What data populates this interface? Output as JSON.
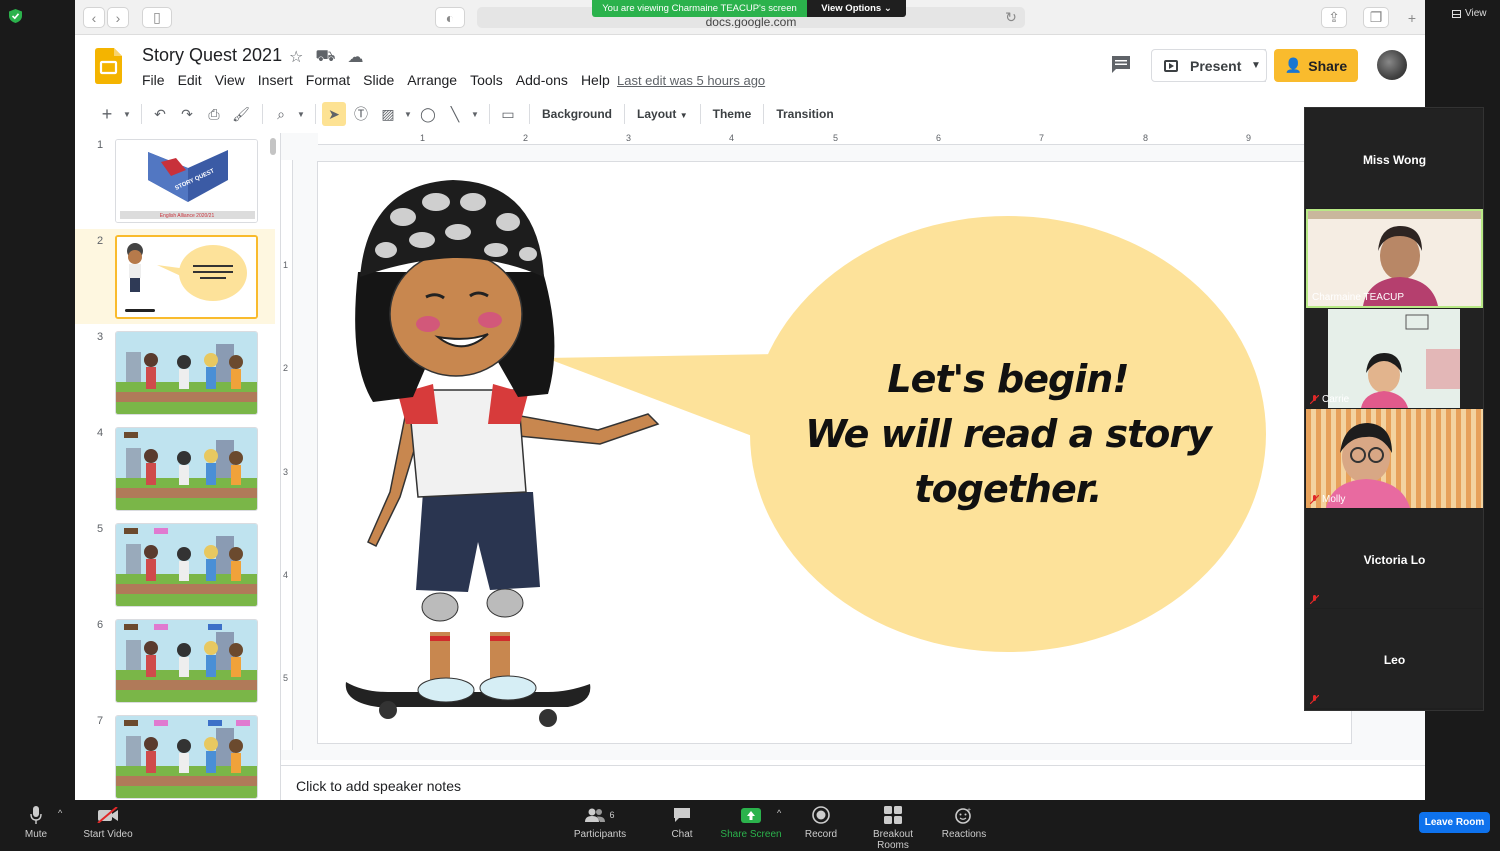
{
  "zoom": {
    "view_label": "View",
    "banner": {
      "viewing_text": "You are viewing Charmaine TEACUP's screen",
      "view_options": "View Options"
    },
    "participants_count": "6",
    "bottom_bar": [
      {
        "label": "Mute",
        "icon": "microphone-icon"
      },
      {
        "label": "Start Video",
        "icon": "video-off-icon"
      },
      {
        "label": "Participants",
        "icon": "participants-icon"
      },
      {
        "label": "Chat",
        "icon": "chat-icon"
      },
      {
        "label": "Share Screen",
        "icon": "share-screen-icon"
      },
      {
        "label": "Record",
        "icon": "record-icon"
      },
      {
        "label": "Breakout Rooms",
        "icon": "breakout-rooms-icon"
      },
      {
        "label": "Reactions",
        "icon": "reactions-icon"
      }
    ],
    "leave_label": "Leave Room",
    "gallery": [
      {
        "name": "Miss Wong",
        "video": false,
        "muted": false
      },
      {
        "name": "Charmaine TEACUP",
        "video": true,
        "muted": false
      },
      {
        "name": "Carrie",
        "video": true,
        "muted": true
      },
      {
        "name": "Molly",
        "video": true,
        "muted": true
      },
      {
        "name": "Victoria Lo",
        "video": false,
        "muted": true
      },
      {
        "name": "Leo",
        "video": false,
        "muted": true
      }
    ]
  },
  "browser": {
    "url": "docs.google.com"
  },
  "slides": {
    "title": "Story Quest 2021",
    "menu": [
      "File",
      "Edit",
      "View",
      "Insert",
      "Format",
      "Slide",
      "Arrange",
      "Tools",
      "Add-ons",
      "Help"
    ],
    "last_edit": "Last edit was 5 hours ago",
    "present_label": "Present",
    "share_label": "Share",
    "toolbar": {
      "background": "Background",
      "layout": "Layout",
      "theme": "Theme",
      "transition": "Transition"
    },
    "ruler_top": [
      "1",
      "2",
      "3",
      "4",
      "5",
      "6",
      "7",
      "8",
      "9"
    ],
    "ruler_left": [
      "1",
      "2",
      "3",
      "4",
      "5"
    ],
    "thumbnails": [
      "1",
      "2",
      "3",
      "4",
      "5",
      "6",
      "7"
    ],
    "selected_slide": 2,
    "thumb1_caption": "English Alliance 2020/21",
    "thumb1_logo_text": "STORY QUEST",
    "slide_text": [
      "Let's begin!",
      "We will read a story",
      "together."
    ],
    "speaker_notes": "Click to add speaker notes",
    "colors": {
      "accent": "#f9bb2d",
      "bubble": "#fde29a",
      "zoom_green": "#2bb24c",
      "zoom_blue": "#0e72ed"
    }
  }
}
